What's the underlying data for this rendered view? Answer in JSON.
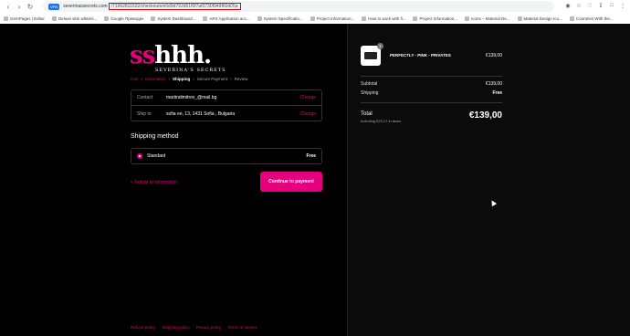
{
  "browser": {
    "url_domain": "severinassecrets.com",
    "url_path": "/71962811532/checkouts/e0d9d792d51f0f7af3730f949f60d05a",
    "vpn_label": "VPN",
    "bookmarks": [
      "GemPages | Editor",
      "Deluxe skin whiteni...",
      "Google Преводач",
      "System Dashboard...",
      "ARX Application acc...",
      "System Specificatio...",
      "Project Information...",
      "How to work with fi...",
      "Project Information...",
      "Icons – Material De...",
      "Material Design Ico...",
      "Countries With the..."
    ]
  },
  "logo": {
    "text_pink": "ss",
    "text_white": "hhh.",
    "subtitle": "SEVERINA'S SECRETS"
  },
  "breadcrumb": {
    "cart": "Cart",
    "information": "Information",
    "shipping": "Shipping",
    "payment": "Secure Payment",
    "review": "Review"
  },
  "info": {
    "contact_label": "Contact",
    "contact_value": "martindimitrov_@mail.bg",
    "ship_label": "Ship to",
    "ship_value": "sofia ee, 13, 1431 Sofia , Bulgaria",
    "change_label": "Change"
  },
  "shipping_method": {
    "title": "Shipping method",
    "option_name": "Standard",
    "option_price": "Free"
  },
  "actions": {
    "return_label": "< Return to information",
    "continue_label": "Continue to payment"
  },
  "footer": [
    "Refund policy",
    "Shipping policy",
    "Privacy policy",
    "Terms of service"
  ],
  "order": {
    "product_name": "PERFECTLY - PINK - PRIVATES",
    "product_price": "€139,00",
    "quantity": "1",
    "subtotal_label": "Subtotal",
    "subtotal_value": "€139,00",
    "shipping_label": "Shipping",
    "shipping_value": "Free",
    "total_label": "Total",
    "taxes_note": "Including €23,17 in taxes",
    "total_value": "€139,00"
  },
  "colors": {
    "accent": "#e6007e",
    "background": "#000000"
  }
}
